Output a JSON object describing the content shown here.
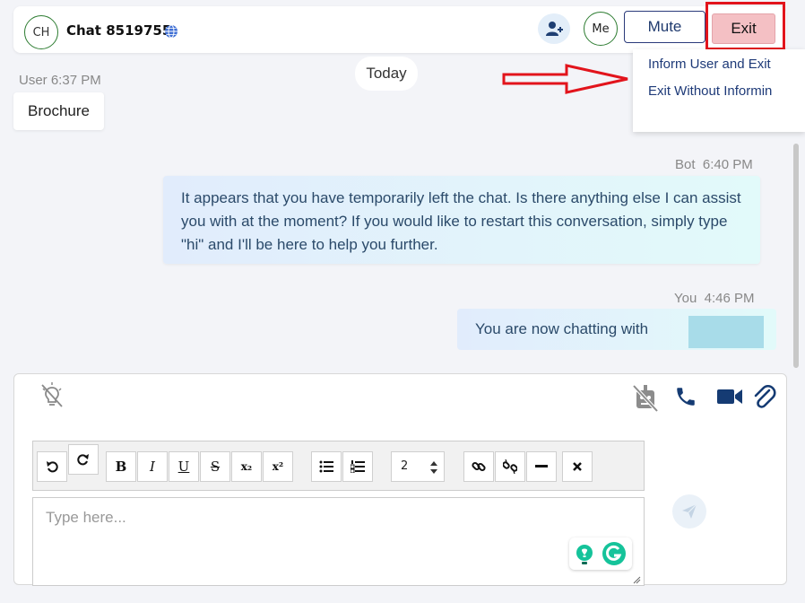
{
  "header": {
    "avatar_initials": "CH",
    "chat_title": "Chat 8519755",
    "me_label": "Me",
    "mute_label": "Mute",
    "exit_label": "Exit"
  },
  "exit_menu": {
    "items": [
      "Inform User and Exit",
      "Exit Without Informin"
    ]
  },
  "chat": {
    "date_divider": "Today",
    "messages": [
      {
        "sender": "User",
        "time": "6:37 PM",
        "meta": "User 6:37 PM",
        "text": "Brochure"
      },
      {
        "sender": "Bot",
        "time": "6:40 PM",
        "meta": "Bot  6:40 PM",
        "text": "It appears that you have temporarily left the chat. Is there anything else I can assist you with at the moment? If you would like to restart this conversation, simply type \"hi\" and I'll be here to help you further."
      },
      {
        "sender": "You",
        "time": "4:46 PM",
        "meta": "You  4:46 PM",
        "text": "You are now chatting with"
      }
    ]
  },
  "composer": {
    "placeholder": "Type here...",
    "font_size_value": "2",
    "toolbar": {
      "bold": "B",
      "italic": "I",
      "underline": "U",
      "strike": "S",
      "subscript": "x₂",
      "superscript": "x²"
    }
  },
  "colors": {
    "accent_navy": "#1e3a78",
    "exit_bg": "#f4c0c4",
    "highlight_red": "#e2141c",
    "avatar_green": "#2e7d32",
    "grammarly_green": "#15c39a"
  }
}
